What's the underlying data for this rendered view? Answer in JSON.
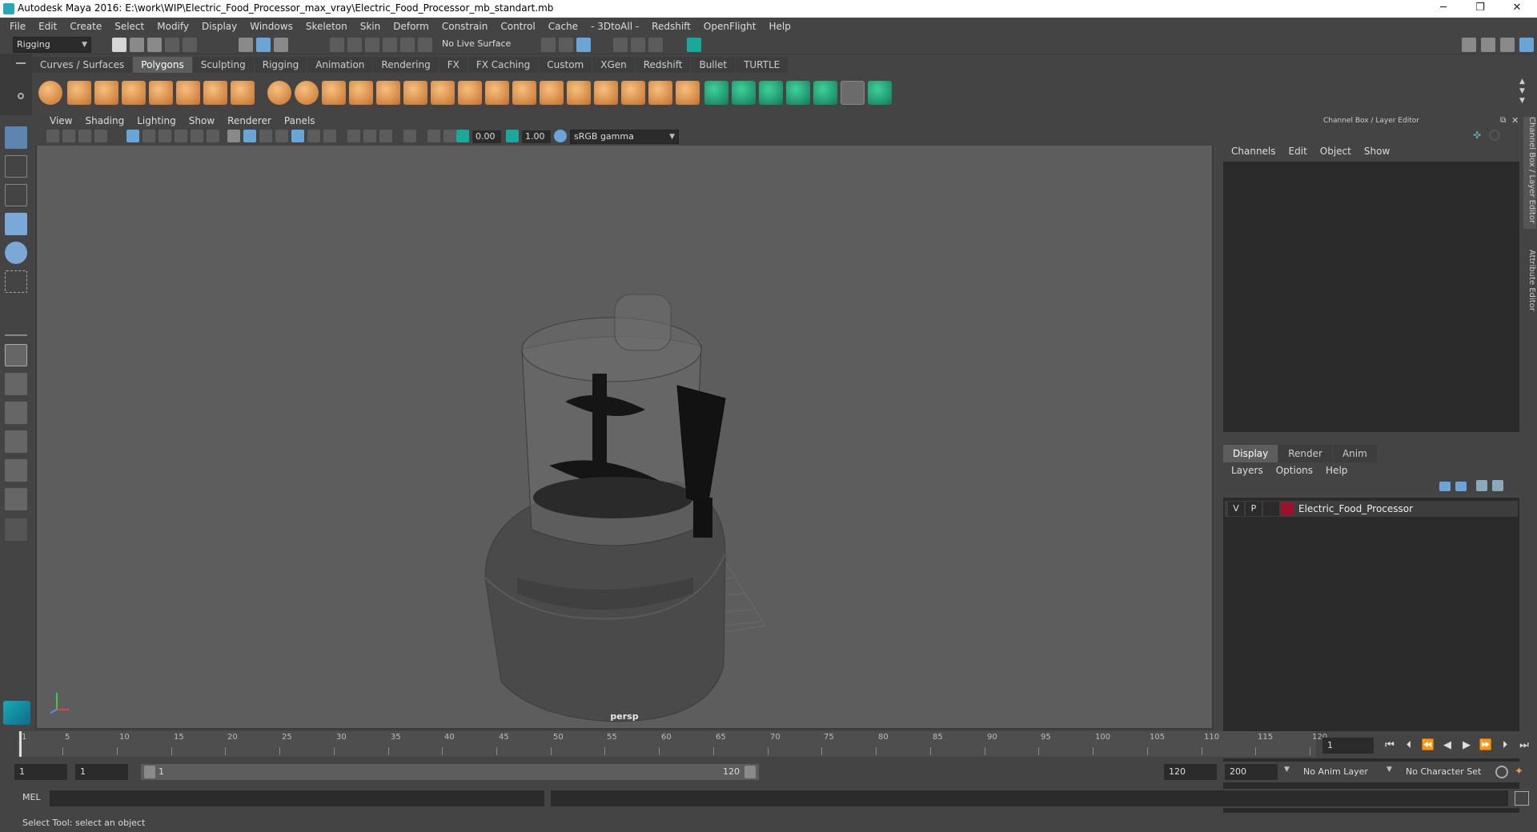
{
  "titlebar": {
    "title": "Autodesk Maya 2016: E:\\work\\WIP\\Electric_Food_Processor_max_vray\\Electric_Food_Processor_mb_standart.mb",
    "minimize": "─",
    "restore": "❐",
    "close": "✕"
  },
  "menubar": [
    "File",
    "Edit",
    "Create",
    "Select",
    "Modify",
    "Display",
    "Windows",
    "Skeleton",
    "Skin",
    "Deform",
    "Constrain",
    "Control",
    "Cache",
    "- 3DtoAll -",
    "Redshift",
    "OpenFlight",
    "Help"
  ],
  "statusline": {
    "mode": "Rigging",
    "live_surface": "No Live Surface"
  },
  "shelf": {
    "tabs": [
      "Curves / Surfaces",
      "Polygons",
      "Sculpting",
      "Rigging",
      "Animation",
      "Rendering",
      "FX",
      "FX Caching",
      "Custom",
      "XGen",
      "Redshift",
      "Bullet",
      "TURTLE"
    ],
    "active_tab": "Polygons"
  },
  "viewport": {
    "menus": [
      "View",
      "Shading",
      "Lighting",
      "Show",
      "Renderer",
      "Panels"
    ],
    "exposure": "0.00",
    "gamma": "1.00",
    "color_space": "sRGB gamma",
    "camera_label": "persp"
  },
  "right_panel": {
    "title": "Channel Box / Layer Editor",
    "cb_menus": [
      "Channels",
      "Edit",
      "Object",
      "Show"
    ],
    "le_tabs": [
      "Display",
      "Render",
      "Anim"
    ],
    "le_active": "Display",
    "le_menus": [
      "Layers",
      "Options",
      "Help"
    ],
    "layer": {
      "v": "V",
      "p": "P",
      "name": "Electric_Food_Processor",
      "color": "#a0102a"
    },
    "vertical_tabs": [
      "Channel Box / Layer Editor",
      "Attribute Editor"
    ]
  },
  "timeline": {
    "ticks": [
      1,
      5,
      10,
      15,
      20,
      25,
      30,
      35,
      40,
      45,
      50,
      55,
      60,
      65,
      70,
      75,
      80,
      85,
      90,
      95,
      100,
      105,
      110,
      115,
      120
    ],
    "current_frame": "1"
  },
  "range": {
    "start": "1",
    "anim_start": "1",
    "slider_start": "1",
    "slider_end": "120",
    "anim_end": "120",
    "end": "200",
    "anim_layer": "No Anim Layer",
    "char_set": "No Character Set"
  },
  "cmdline": {
    "label": "MEL"
  },
  "helpline": {
    "text": "Select Tool: select an object"
  },
  "colors": {
    "accent": "#5c86b0",
    "shelf_orange": "#e0954a",
    "shelf_green": "#1aa89a"
  }
}
